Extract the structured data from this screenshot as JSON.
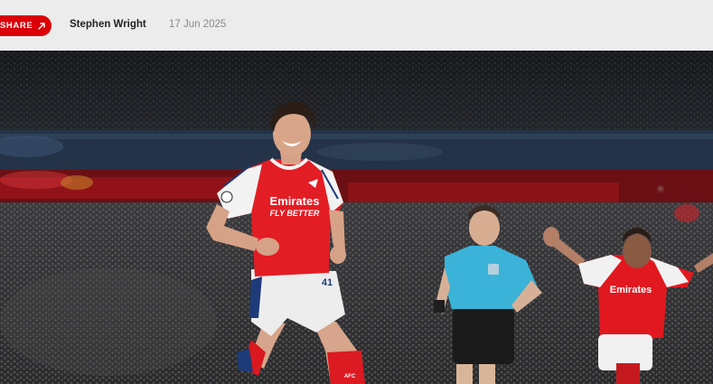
{
  "article": {
    "headline_fragment": "",
    "share_label": "SHARE",
    "author": "Stephen Wright",
    "date": "17 Jun 2025"
  },
  "hero": {
    "shirt_sponsor": "Emirates",
    "shirt_slogan": "FLY BETTER",
    "shirt_number": "41",
    "second_player_sponsor": "Emirates"
  },
  "colors": {
    "brand_red": "#db0007",
    "referee_kit": "#3bb3d8",
    "background_bar": "#ececec"
  },
  "icons": {
    "share": "share-arrow-icon"
  }
}
